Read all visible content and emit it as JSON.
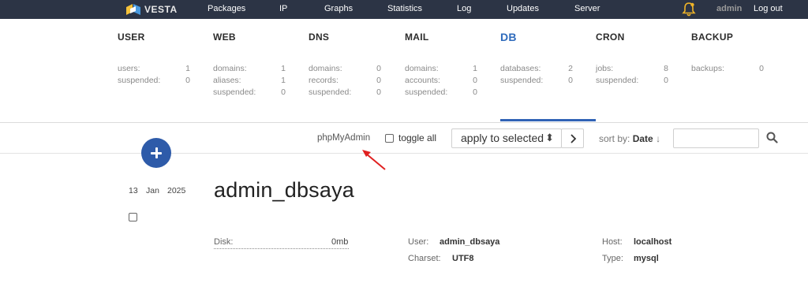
{
  "topnav": {
    "logo_text": "VESTA",
    "items": [
      "Packages",
      "IP",
      "Graphs",
      "Statistics",
      "Log",
      "Updates",
      "Server"
    ],
    "username": "admin",
    "logout_label": "Log out"
  },
  "panel": {
    "active_tab": "DB",
    "columns": [
      {
        "title": "USER",
        "stats": [
          {
            "label": "users:",
            "value": "1"
          },
          {
            "label": "suspended:",
            "value": "0"
          }
        ]
      },
      {
        "title": "WEB",
        "stats": [
          {
            "label": "domains:",
            "value": "1"
          },
          {
            "label": "aliases:",
            "value": "1"
          },
          {
            "label": "suspended:",
            "value": "0"
          }
        ]
      },
      {
        "title": "DNS",
        "stats": [
          {
            "label": "domains:",
            "value": "0"
          },
          {
            "label": "records:",
            "value": "0"
          },
          {
            "label": "suspended:",
            "value": "0"
          }
        ]
      },
      {
        "title": "MAIL",
        "stats": [
          {
            "label": "domains:",
            "value": "1"
          },
          {
            "label": "accounts:",
            "value": "0"
          },
          {
            "label": "suspended:",
            "value": "0"
          }
        ]
      },
      {
        "title": "DB",
        "stats": [
          {
            "label": "databases:",
            "value": "2"
          },
          {
            "label": "suspended:",
            "value": "0"
          }
        ]
      },
      {
        "title": "CRON",
        "stats": [
          {
            "label": "jobs:",
            "value": "8"
          },
          {
            "label": "suspended:",
            "value": "0"
          }
        ]
      },
      {
        "title": "BACKUP",
        "stats": [
          {
            "label": "backups:",
            "value": "0"
          }
        ]
      }
    ]
  },
  "toolbar": {
    "phpmyadmin_label": "phpMyAdmin",
    "toggle_all_label": "toggle all",
    "bulk_action_selected": "apply to selected",
    "apply_symbol": ">",
    "sort_prefix": "sort by:",
    "sort_field": "Date",
    "sort_arrow": "↓",
    "search_value": ""
  },
  "record": {
    "day": "13",
    "month": "Jan",
    "year": "2025",
    "name": "admin_dbsaya",
    "disk_label": "Disk:",
    "disk_value": "0mb",
    "user_label": "User:",
    "user_value": "admin_dbsaya",
    "charset_label": "Charset:",
    "charset_value": "UTF8",
    "host_label": "Host:",
    "host_value": "localhost",
    "type_label": "Type:",
    "type_value": "mysql"
  },
  "colors": {
    "topnav_bg": "#2c3445",
    "accent_blue": "#2e5ba9",
    "active_tab": "#2f6bbc",
    "bell": "#f0b428",
    "annotation_arrow": "#e02020"
  },
  "icons": {
    "logo": "vesta-logo-icon",
    "bell": "bell-icon",
    "add": "plus-circle-icon",
    "search": "search-icon",
    "sort": "sort-arrows-icon"
  }
}
